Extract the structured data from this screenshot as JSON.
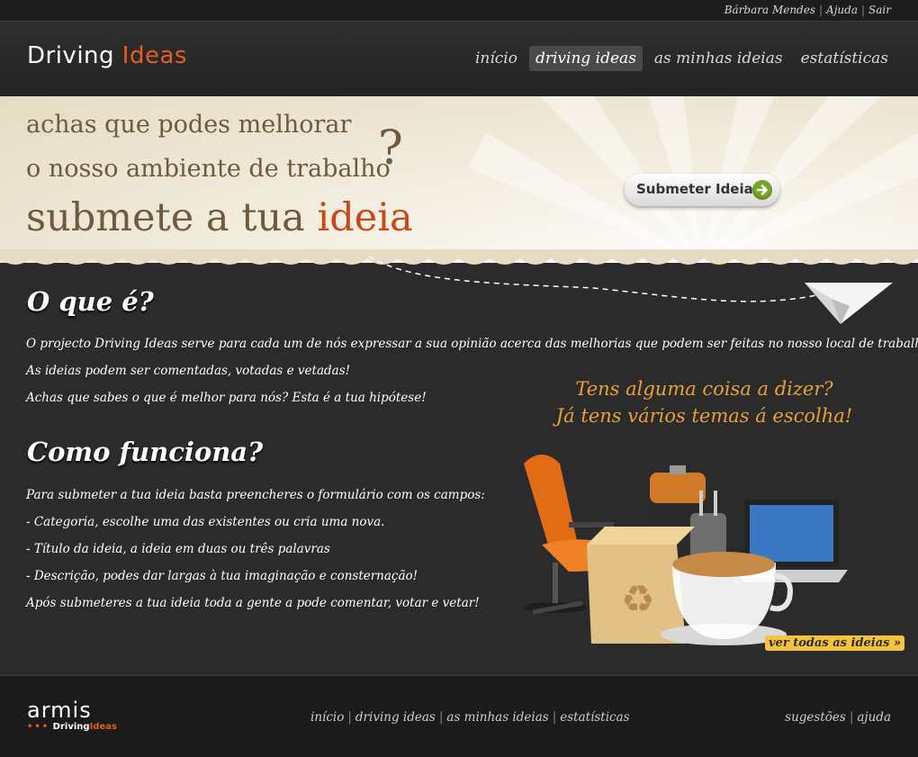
{
  "userbar": {
    "user": "Bárbara Mendes",
    "help": "Ajuda",
    "logout": "Sair"
  },
  "header": {
    "logo_part1": "Driving",
    "logo_part2": "Ideas",
    "nav": [
      "início",
      "driving ideas",
      "as minhas ideias",
      "estatísticas"
    ],
    "active_nav": "driving ideas"
  },
  "hero": {
    "line1": "achas que podes melhorar",
    "line2": "o nosso ambiente de trabalho",
    "question_mark": "?",
    "line3_prefix": "submete a tua ",
    "line3_accent": "ideia",
    "submit_label": "Submeter Ideia"
  },
  "about": {
    "title": "O que é?",
    "paragraphs": [
      "O projecto Driving Ideas serve para cada um de nós expressar a sua opinião acerca das melhorias que podem ser feitas no nosso local de trabalho.",
      "As ideias podem ser comentadas, votadas e vetadas!",
      "Achas que sabes o que é melhor para nós? Esta é a tua hipótese!"
    ]
  },
  "how": {
    "title": "Como funciona?",
    "paragraphs": [
      "Para submeter a tua ideia basta preencheres o formulário com os campos:",
      "- Categoria, escolhe uma das existentes ou cria uma nova.",
      "- Título da ideia, a ideia em duas ou três palavras",
      "- Descrição, podes dar largas à tua imaginação e consternação!",
      "Após submeteres a tua ideia toda a gente a pode comentar, votar e vetar!"
    ]
  },
  "promo": {
    "line1": "Tens alguma coisa a dizer?",
    "line2": "Já tens vários temas á escolha!",
    "see_all": "ver todas as ideias »"
  },
  "footer": {
    "brand": "armis",
    "sub_prefix": "Driving",
    "sub_accent": "Ideas",
    "nav": [
      "início",
      "driving ideas",
      "as minhas ideias",
      "estatísticas"
    ],
    "right": [
      "sugestões",
      "ajuda"
    ]
  },
  "colors": {
    "accent_orange": "#e0601d",
    "hero_accent": "#c7481a",
    "promo_text": "#e6a237",
    "button_green": "#7aa62a"
  }
}
